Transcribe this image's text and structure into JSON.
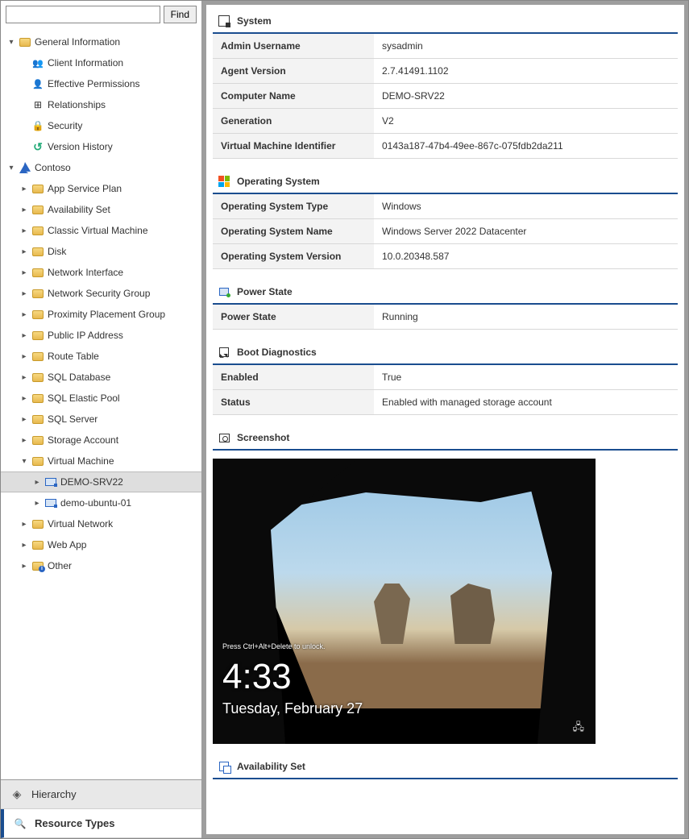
{
  "search": {
    "find_label": "Find",
    "value": ""
  },
  "tree": {
    "general_info": "General Information",
    "client_info": "Client Information",
    "effective_perms": "Effective Permissions",
    "relationships": "Relationships",
    "security": "Security",
    "version_history": "Version History",
    "contoso": "Contoso",
    "app_service_plan": "App Service Plan",
    "availability_set": "Availability Set",
    "classic_vm": "Classic Virtual Machine",
    "disk": "Disk",
    "network_interface": "Network Interface",
    "nsg": "Network Security Group",
    "ppg": "Proximity Placement Group",
    "public_ip": "Public IP Address",
    "route_table": "Route Table",
    "sql_db": "SQL Database",
    "sql_elastic": "SQL Elastic Pool",
    "sql_server": "SQL Server",
    "storage_account": "Storage Account",
    "virtual_machine": "Virtual Machine",
    "demo_srv22": "DEMO-SRV22",
    "demo_ubuntu": "demo-ubuntu-01",
    "virtual_network": "Virtual Network",
    "web_app": "Web App",
    "other": "Other"
  },
  "tabs": {
    "hierarchy": "Hierarchy",
    "resource_types": "Resource Types"
  },
  "sections": {
    "system": {
      "title": "System",
      "rows": [
        {
          "key": "Admin Username",
          "val": "sysadmin"
        },
        {
          "key": "Agent Version",
          "val": "2.7.41491.1102"
        },
        {
          "key": "Computer Name",
          "val": "DEMO-SRV22"
        },
        {
          "key": "Generation",
          "val": "V2"
        },
        {
          "key": "Virtual Machine Identifier",
          "val": "0143a187-47b4-49ee-867c-075fdb2da211"
        }
      ]
    },
    "os": {
      "title": "Operating System",
      "rows": [
        {
          "key": "Operating System Type",
          "val": "Windows"
        },
        {
          "key": "Operating System Name",
          "val": "Windows Server 2022 Datacenter"
        },
        {
          "key": "Operating System Version",
          "val": "10.0.20348.587"
        }
      ]
    },
    "power": {
      "title": "Power State",
      "rows": [
        {
          "key": "Power State",
          "val": "Running"
        }
      ]
    },
    "boot": {
      "title": "Boot Diagnostics",
      "rows": [
        {
          "key": "Enabled",
          "val": "True"
        },
        {
          "key": "Status",
          "val": "Enabled with managed storage account"
        }
      ]
    },
    "screenshot": {
      "title": "Screenshot",
      "lock_hint": "Press Ctrl+Alt+Delete to unlock.",
      "time": "4:33",
      "date": "Tuesday, February 27"
    },
    "avail": {
      "title": "Availability Set"
    }
  }
}
